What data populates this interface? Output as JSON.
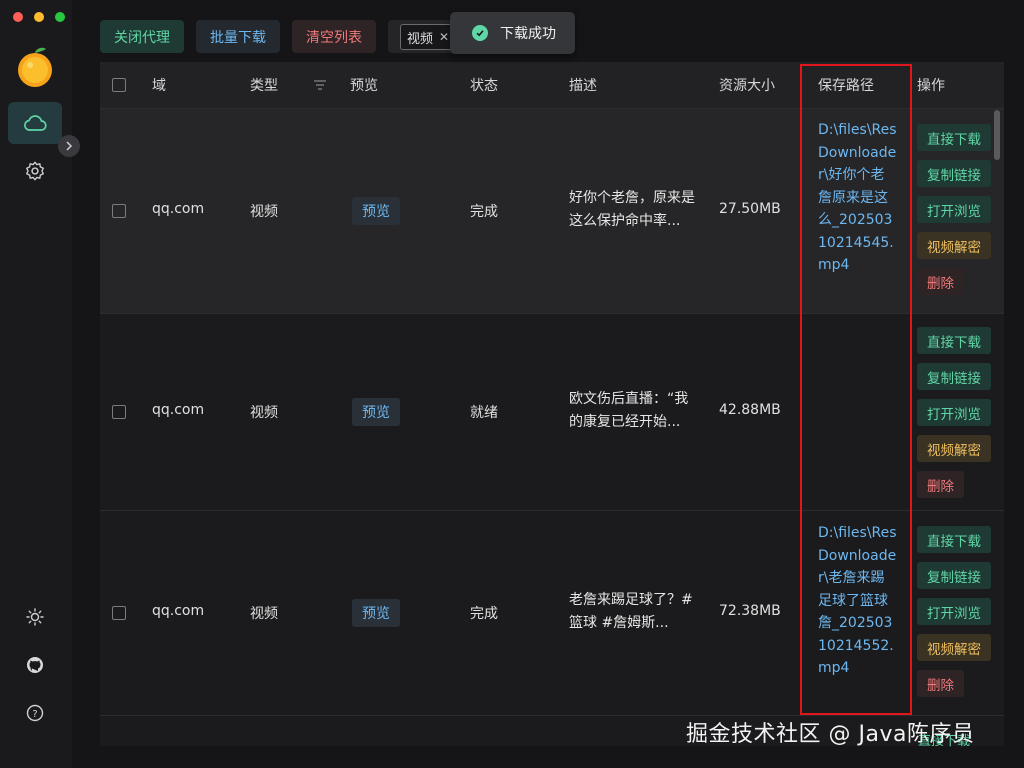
{
  "colors": {
    "accent_green": "#5fd6a6",
    "accent_blue": "#6db7f0",
    "accent_red": "#f07a7a",
    "accent_yellow": "#f0c060",
    "highlight_box": "#e0161b"
  },
  "sidebar": {
    "icons": [
      "orange-logo",
      "cloud-icon",
      "gear-icon",
      "chevron-right-icon",
      "sun-icon",
      "github-icon",
      "help-icon"
    ]
  },
  "toolbar": {
    "close_proxy": "关闭代理",
    "batch_download": "批量下载",
    "clear_list": "清空列表",
    "filter_tag": "视频",
    "filter_close": "✕"
  },
  "toast": {
    "message": "下载成功"
  },
  "table": {
    "headers": {
      "domain": "域",
      "type": "类型",
      "preview": "预览",
      "status": "状态",
      "description": "描述",
      "size": "资源大小",
      "path": "保存路径",
      "actions": "操作"
    },
    "rows": [
      {
        "domain": "qq.com",
        "type": "视频",
        "preview": "预览",
        "status": "完成",
        "desc_line1": "好你个老詹，原来是",
        "desc_line2": "这么保护命中率...",
        "size": "27.50MB",
        "path": "D:\\files\\ResDownloader\\好你个老詹原来是这么_20250310214545.mp4",
        "actions": {
          "direct": "直接下载",
          "copy": "复制链接",
          "open": "打开浏览",
          "decode": "视频解密",
          "delete": "删除"
        }
      },
      {
        "domain": "qq.com",
        "type": "视频",
        "preview": "预览",
        "status": "就绪",
        "desc_line1": "欧文伤后直播：“我",
        "desc_line2": "的康复已经开始...",
        "size": "42.88MB",
        "path": "",
        "actions": {
          "direct": "直接下载",
          "copy": "复制链接",
          "open": "打开浏览",
          "decode": "视频解密",
          "delete": "删除"
        }
      },
      {
        "domain": "qq.com",
        "type": "视频",
        "preview": "预览",
        "status": "完成",
        "desc_line1": "老詹来踢足球了？#",
        "desc_line2": "篮球 #詹姆斯...",
        "size": "72.38MB",
        "path": "D:\\files\\ResDownloader\\老詹来踢足球了篮球詹_20250310214552.mp4",
        "actions": {
          "direct": "直接下载",
          "copy": "复制链接",
          "open": "打开浏览",
          "decode": "视频解密",
          "delete": "删除"
        }
      }
    ],
    "peek_action": "直接下载"
  },
  "watermark": "掘金技术社区 @ Java陈序员"
}
